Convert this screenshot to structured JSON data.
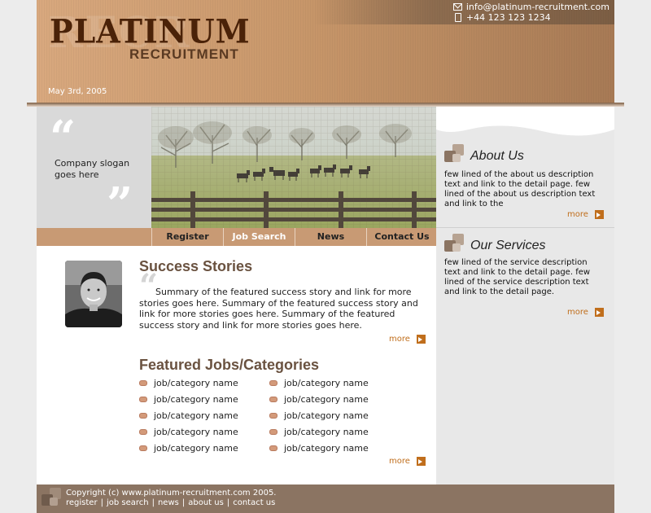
{
  "header": {
    "logo_main": "PLATINUM",
    "logo_sub": "RECRUITMENT",
    "logo_ghost": "RECR",
    "date": "May 3rd, 2005",
    "email": "info@platinum-recruitment.com",
    "phone": "+44 123 123 1234"
  },
  "slogan": {
    "text": "Company slogan goes here"
  },
  "nav": {
    "items": [
      {
        "label": "Register"
      },
      {
        "label": "Job Search",
        "active": true
      },
      {
        "label": "News"
      },
      {
        "label": "Contact Us"
      }
    ]
  },
  "success": {
    "title": "Success Stories",
    "text": "Summary of the featured success story and link for more stories goes here. Summary of the featured success story and link for more stories goes here. Summary of the featured success story and link for more stories goes here.",
    "more": "more"
  },
  "jobs": {
    "title": "Featured Jobs/Categories",
    "col1": [
      "job/category name",
      "job/category name",
      "job/category name",
      "job/category name",
      "job/category name"
    ],
    "col2": [
      "job/category name",
      "job/category name",
      "job/category name",
      "job/category name",
      "job/category name"
    ],
    "more": "more"
  },
  "sidebar": {
    "about": {
      "title": "About Us",
      "text": "few lined of the about us description text and link to the detail page. few lined of the about us description text and link to the",
      "more": "more"
    },
    "services": {
      "title": "Our Services",
      "text": "few lined of the service description text and link to the detail page. few lined of the service description text and link to the detail page.",
      "more": "more"
    }
  },
  "footer": {
    "copyright": "Copyright (c) www.platinum-recruitment.com 2005.",
    "links": [
      "register",
      "job search",
      "news",
      "about us",
      "contact us"
    ]
  },
  "colors": {
    "header_tan": "#c8976a",
    "nav_tan": "#c89a74",
    "accent_orange": "#c06e1c",
    "heading_brown": "#6a5240",
    "footer_brown": "#8b7462"
  }
}
